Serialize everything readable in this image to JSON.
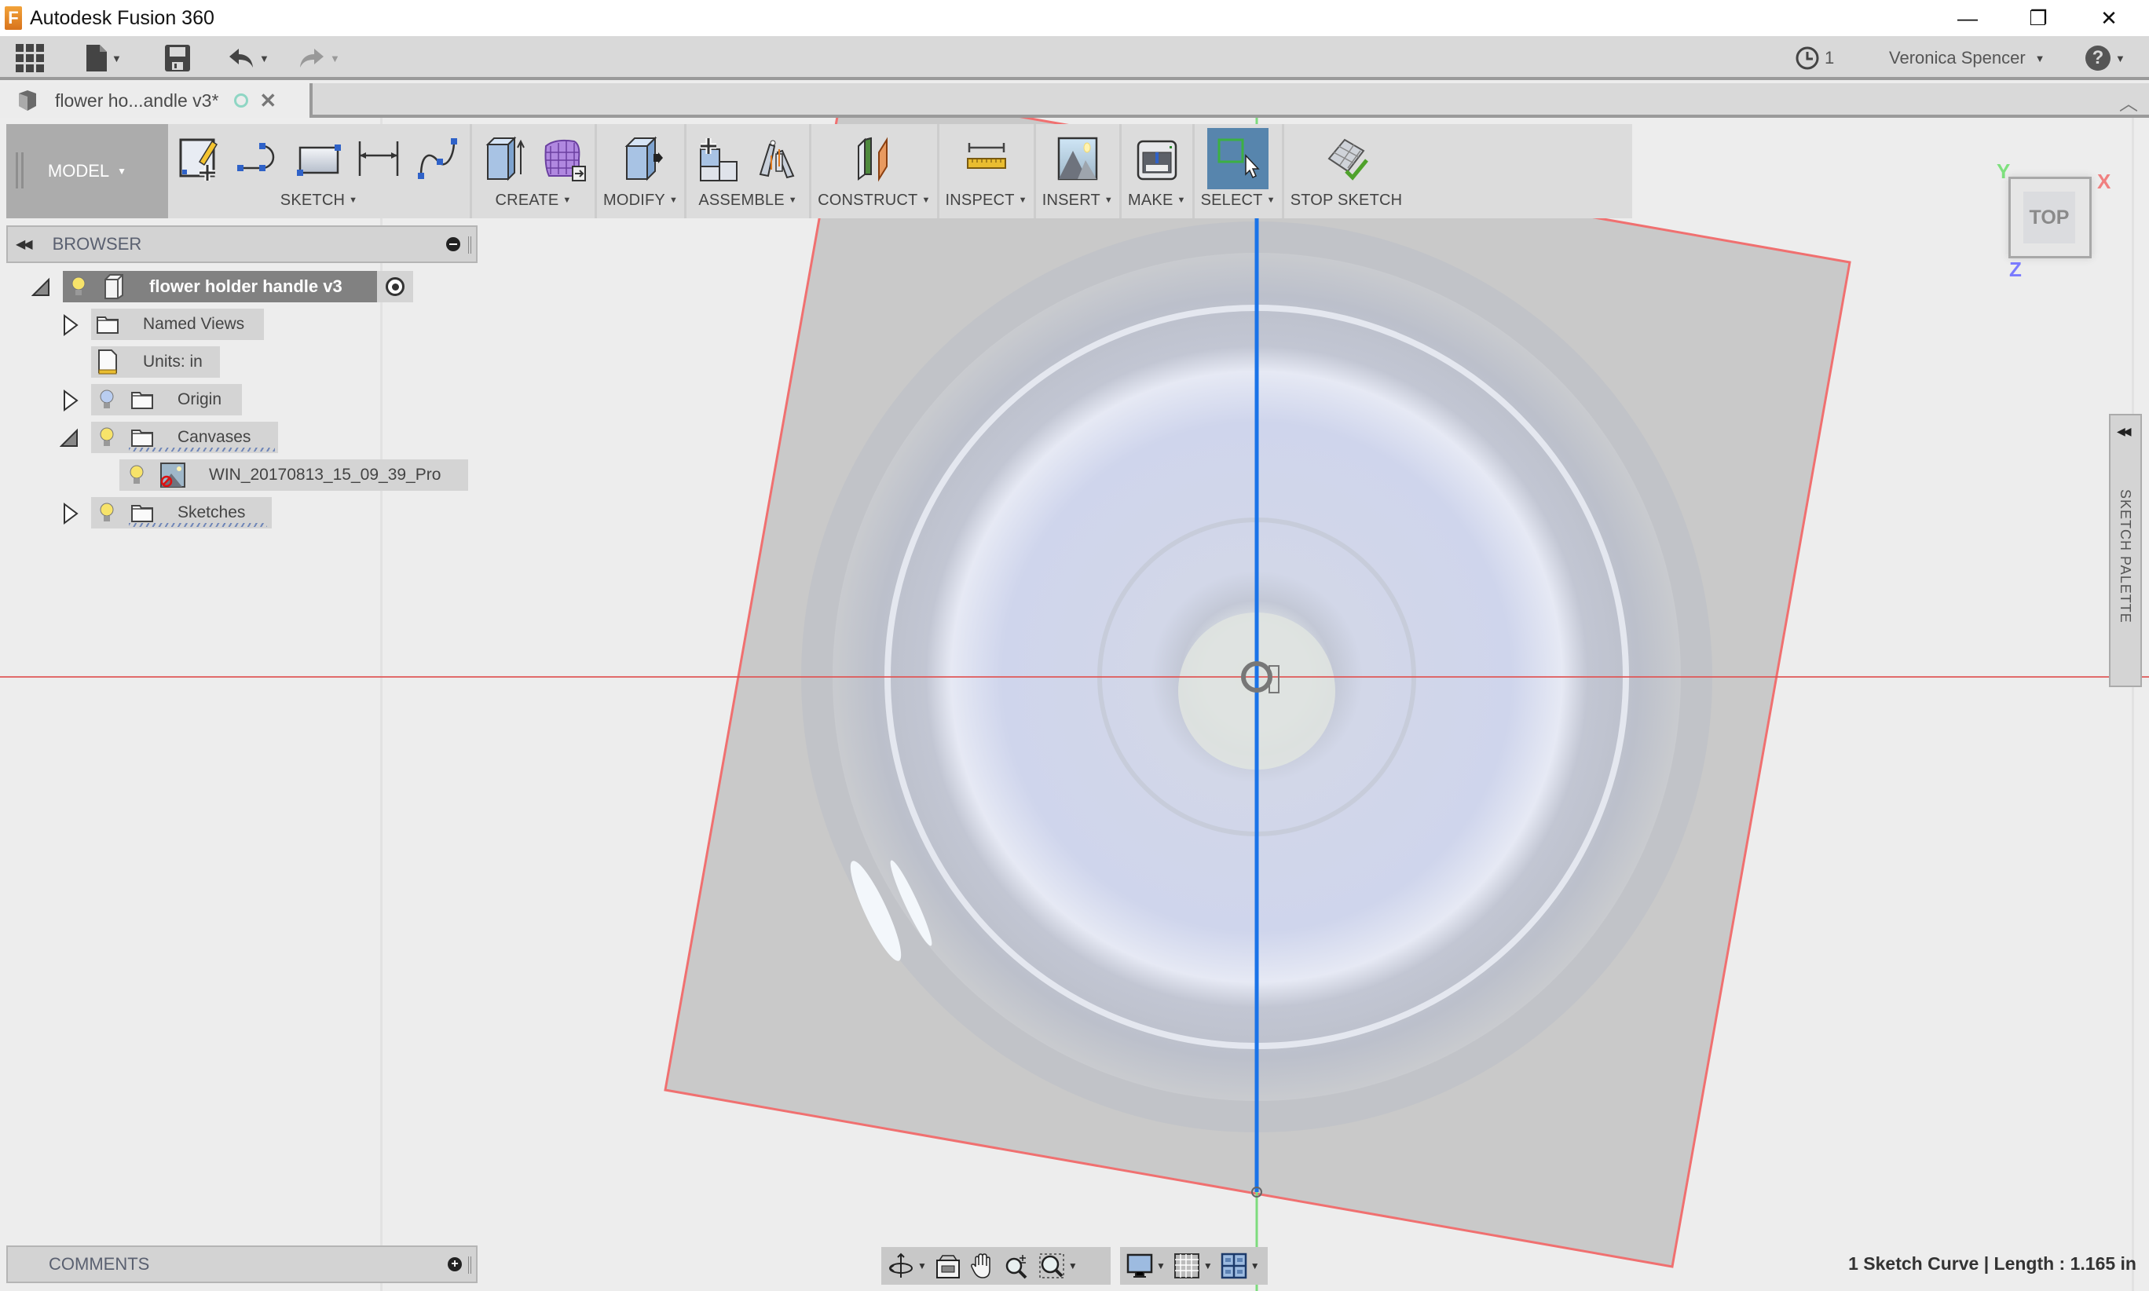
{
  "window": {
    "title": "Autodesk Fusion 360",
    "logo_letter": "F",
    "controls": {
      "minimize": "—",
      "restore": "❐",
      "close": "✕"
    }
  },
  "quick_access": {
    "jobs_count": "1",
    "user_name": "Veronica Spencer",
    "help_glyph": "?"
  },
  "document_tab": {
    "label": "flower ho...andle v3*",
    "close_glyph": "✕",
    "collapse_glyph": "︿"
  },
  "toolbar": {
    "workspace": "MODEL",
    "groups": [
      {
        "label": "SKETCH",
        "dropdown": true
      },
      {
        "label": "CREATE",
        "dropdown": true
      },
      {
        "label": "MODIFY",
        "dropdown": true
      },
      {
        "label": "ASSEMBLE",
        "dropdown": true
      },
      {
        "label": "CONSTRUCT",
        "dropdown": true
      },
      {
        "label": "INSPECT",
        "dropdown": true
      },
      {
        "label": "INSERT",
        "dropdown": true
      },
      {
        "label": "MAKE",
        "dropdown": true
      },
      {
        "label": "SELECT",
        "dropdown": true
      },
      {
        "label": "STOP SKETCH",
        "dropdown": false
      }
    ],
    "dropdown_glyph": "▼"
  },
  "browser": {
    "title": "BROWSER",
    "items": [
      {
        "label": "flower holder handle v3",
        "expanded": true,
        "bulb": "on"
      },
      {
        "label": "Named Views",
        "expanded": false
      },
      {
        "label": "Units: in"
      },
      {
        "label": "Origin",
        "expanded": false,
        "bulb": "off"
      },
      {
        "label": "Canvases",
        "expanded": true,
        "bulb": "on"
      },
      {
        "label": "WIN_20170813_15_09_39_Pro",
        "bulb": "on"
      },
      {
        "label": "Sketches",
        "expanded": false,
        "bulb": "on"
      }
    ]
  },
  "comments": {
    "title": "COMMENTS",
    "plus": "+"
  },
  "viewcube": {
    "face": "TOP",
    "axis_x": "X",
    "axis_y": "Y",
    "axis_z": "Z"
  },
  "sketch_palette": {
    "title": "SKETCH PALETTE"
  },
  "status": {
    "text": "1 Sketch Curve | Length : 1.165 in"
  },
  "colors": {
    "x_axis": "#e05555",
    "y_axis": "#7ddc7d",
    "selected_curve": "#1a73e8",
    "select_active": "#5785ad"
  }
}
